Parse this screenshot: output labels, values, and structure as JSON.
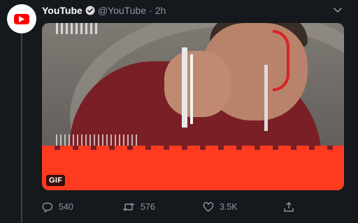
{
  "tweet": {
    "author_name": "YouTube",
    "handle": "@YouTube",
    "separator": "·",
    "time": "2h",
    "verified_icon": "verified-badge-icon",
    "avatar_icon": "youtube-logo-icon",
    "more_icon": "chevron-down-icon"
  },
  "media": {
    "badge": "GIF",
    "accent_color": "#ff3b1f"
  },
  "actions": {
    "reply_count": "540",
    "retweet_count": "576",
    "like_count": "3.5K",
    "reply_icon": "reply-icon",
    "retweet_icon": "retweet-icon",
    "like_icon": "heart-icon",
    "share_icon": "share-icon"
  },
  "colors": {
    "background": "#15181c",
    "muted_text": "#8b98a5",
    "youtube_red": "#ff0000"
  }
}
